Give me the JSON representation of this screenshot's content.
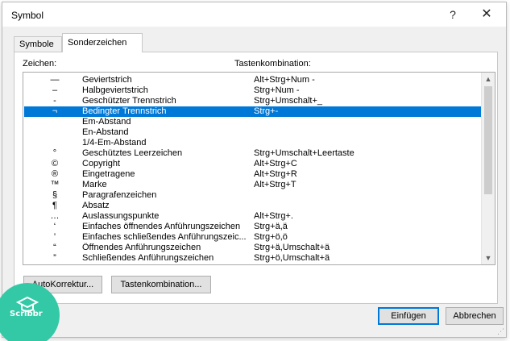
{
  "window": {
    "title": "Symbol"
  },
  "titlebar": {
    "help": "?",
    "close": "✕"
  },
  "tabs": [
    {
      "label": "Symbole",
      "active": false
    },
    {
      "label": "Sonderzeichen",
      "active": true
    }
  ],
  "columns": {
    "zeichen": "Zeichen:",
    "tasten": "Tastenkombination:"
  },
  "rows": [
    {
      "char": "—",
      "name": "Geviertstrich",
      "keys": "Alt+Strg+Num -"
    },
    {
      "char": "–",
      "name": "Halbgeviertstrich",
      "keys": "Strg+Num -"
    },
    {
      "char": "‑",
      "name": "Geschützter Trennstrich",
      "keys": "Strg+Umschalt+_"
    },
    {
      "char": "¬",
      "name": "Bedingter Trennstrich",
      "keys": "Strg+-",
      "selected": true
    },
    {
      "char": "",
      "name": "Em-Abstand",
      "keys": ""
    },
    {
      "char": "",
      "name": "En-Abstand",
      "keys": ""
    },
    {
      "char": "",
      "name": "1/4-Em-Abstand",
      "keys": ""
    },
    {
      "char": "°",
      "name": "Geschütztes Leerzeichen",
      "keys": "Strg+Umschalt+Leertaste"
    },
    {
      "char": "©",
      "name": "Copyright",
      "keys": "Alt+Strg+C"
    },
    {
      "char": "®",
      "name": "Eingetragene",
      "keys": "Alt+Strg+R"
    },
    {
      "char": "™",
      "name": "Marke",
      "keys": "Alt+Strg+T"
    },
    {
      "char": "§",
      "name": "Paragrafenzeichen",
      "keys": ""
    },
    {
      "char": "¶",
      "name": "Absatz",
      "keys": ""
    },
    {
      "char": "…",
      "name": "Auslassungspunkte",
      "keys": "Alt+Strg+."
    },
    {
      "char": "‘",
      "name": "Einfaches öffnendes Anführungszeichen",
      "keys": "Strg+ä,ä"
    },
    {
      "char": "’",
      "name": "Einfaches schließendes Anführungszeic...",
      "keys": "Strg+ö,ö"
    },
    {
      "char": "“",
      "name": "Öffnendes Anführungszeichen",
      "keys": "Strg+ä,Umschalt+ä"
    },
    {
      "char": "”",
      "name": "Schließendes Anführungszeichen",
      "keys": "Strg+ö,Umschalt+ä"
    }
  ],
  "buttons": {
    "autokorrektur": "AutoKorrektur...",
    "tastenkombination": "Tastenkombination...",
    "einfuegen": "Einfügen",
    "abbrechen": "Abbrechen"
  },
  "logo": {
    "text": "Scribbr",
    "color": "#33c9a6"
  },
  "colors": {
    "selection": "#0078d7",
    "default_button_border": "#0078d7"
  }
}
